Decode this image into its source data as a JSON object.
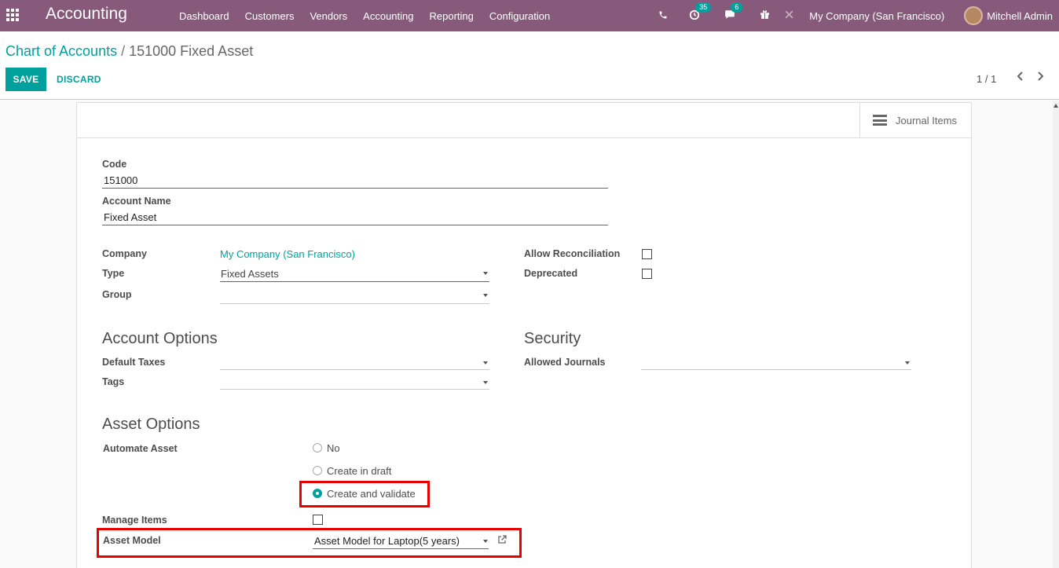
{
  "topbar": {
    "app_name": "Accounting",
    "menu": [
      "Dashboard",
      "Customers",
      "Vendors",
      "Accounting",
      "Reporting",
      "Configuration"
    ],
    "activity_count": "35",
    "message_count": "6",
    "company": "My Company (San Francisco)",
    "user": "Mitchell Admin"
  },
  "breadcrumb": {
    "parent": "Chart of Accounts",
    "separator": "/",
    "current": "151000 Fixed Asset"
  },
  "buttons": {
    "save": "SAVE",
    "discard": "DISCARD"
  },
  "pager": {
    "text": "1 / 1"
  },
  "smart_buttons": {
    "journal_items": "Journal Items"
  },
  "form": {
    "code_label": "Code",
    "code_value": "151000",
    "name_label": "Account Name",
    "name_value": "Fixed Asset",
    "company_label": "Company",
    "company_value": "My Company (San Francisco)",
    "type_label": "Type",
    "type_value": "Fixed Assets",
    "group_label": "Group",
    "group_value": "",
    "allow_reconciliation_label": "Allow Reconciliation",
    "allow_reconciliation": false,
    "deprecated_label": "Deprecated",
    "deprecated": false,
    "account_options_title": "Account Options",
    "default_taxes_label": "Default Taxes",
    "tags_label": "Tags",
    "security_title": "Security",
    "allowed_journals_label": "Allowed Journals",
    "asset_options_title": "Asset Options",
    "automate_asset_label": "Automate Asset",
    "automate_options": [
      "No",
      "Create in draft",
      "Create and validate"
    ],
    "automate_selected": "Create and validate",
    "manage_items_label": "Manage Items",
    "manage_items": false,
    "asset_model_label": "Asset Model",
    "asset_model_value": "Asset Model for Laptop(5 years)"
  },
  "colors": {
    "nav": "#875a7b",
    "accent": "#00a09d",
    "highlight": "#e80000"
  }
}
